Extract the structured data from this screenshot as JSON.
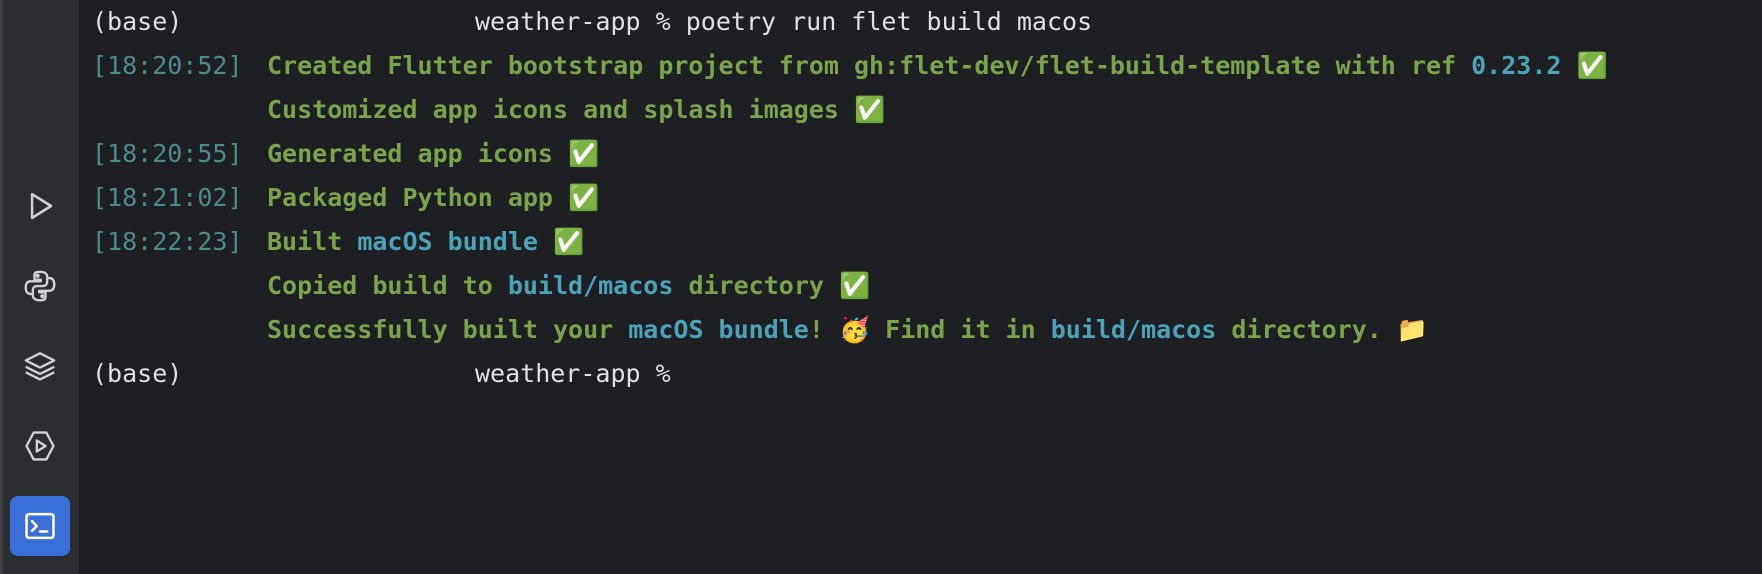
{
  "sidebar": {
    "tools": [
      {
        "name": "run-icon",
        "label": "Run"
      },
      {
        "name": "python-icon",
        "label": "Python Console"
      },
      {
        "name": "layers-icon",
        "label": "Services"
      },
      {
        "name": "services-run-icon",
        "label": "Services Run"
      },
      {
        "name": "terminal-icon",
        "label": "Terminal"
      }
    ],
    "active": "terminal-icon"
  },
  "terminal": {
    "prompt_env": "(base)",
    "prompt_dir": "weather-app %",
    "command": "poetry run flet build macos",
    "lines": [
      {
        "ts": "[18:20:52]",
        "parts": [
          "Created Flutter bootstrap project from gh:flet-dev/flet-build-template with ref ",
          "0.23.2",
          " ✅"
        ]
      },
      {
        "ts": "",
        "parts": [
          "Customized app icons and splash images ✅"
        ]
      },
      {
        "ts": "[18:20:55]",
        "parts": [
          "Generated app icons ✅"
        ]
      },
      {
        "ts": "[18:21:02]",
        "parts": [
          "Packaged Python app ✅"
        ]
      },
      {
        "ts": "[18:22:23]",
        "parts": [
          "Built ",
          "macOS bundle",
          " ✅"
        ]
      },
      {
        "ts": "",
        "parts": [
          "Copied build to ",
          "build/macos",
          " directory ✅"
        ]
      },
      {
        "ts": "",
        "parts": [
          "Successfully built your ",
          "macOS bundle",
          "! 🥳 Find it in ",
          "build/macos",
          " directory. 📁"
        ]
      }
    ],
    "colors": {
      "background": "#1e1f22",
      "timestamp": "#4e8a8a",
      "success": "#7aa34c",
      "highlight": "#4aa3b8",
      "prompt": "#dfe1e5",
      "active_tool": "#3a6fd8"
    }
  }
}
